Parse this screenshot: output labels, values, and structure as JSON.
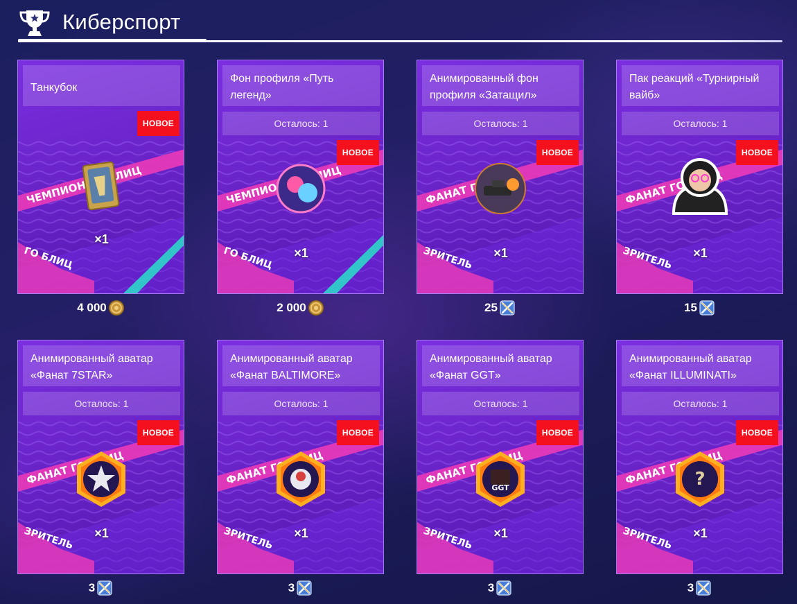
{
  "header": {
    "title": "Киберспорт",
    "icon": "trophy-icon"
  },
  "colors": {
    "badge": "#f5101e",
    "card": "#6a24c9",
    "accent_pink": "#e83ab8",
    "background": "#1b1f5e"
  },
  "cards": [
    {
      "title": "Танкубок",
      "remaining": "",
      "badge": "НОВОЕ",
      "quantity": "×1",
      "price": "4 000",
      "currency_icon": "gold-coin-icon",
      "item_icon": "tank-cup-icon"
    },
    {
      "title": "Фон профиля «Путь легенд»",
      "remaining": "Осталось: 1",
      "badge": "НОВОЕ",
      "quantity": "×1",
      "price": "2 000",
      "currency_icon": "gold-coin-icon",
      "item_icon": "profile-background-icon"
    },
    {
      "title": "Анимированный фон профиля «Затащил»",
      "remaining": "Осталось: 1",
      "badge": "НОВОЕ",
      "quantity": "×1",
      "price": "25",
      "currency_icon": "crossed-swords-icon",
      "item_icon": "animated-background-icon"
    },
    {
      "title": "Пак реакций «Турнирный вайб»",
      "remaining": "Осталось: 1",
      "badge": "НОВОЕ",
      "quantity": "×1",
      "price": "15",
      "currency_icon": "crossed-swords-icon",
      "item_icon": "reaction-pack-icon"
    },
    {
      "title": "Анимированный аватар «Фанат 7STAR»",
      "remaining": "Осталось: 1",
      "badge": "НОВОЕ",
      "quantity": "×1",
      "price": "3",
      "currency_icon": "crossed-swords-icon",
      "item_icon": "star-avatar-icon"
    },
    {
      "title": "Анимированный аватар «Фанат BALTIMORE»",
      "remaining": "Осталось: 1",
      "badge": "НОВОЕ",
      "quantity": "×1",
      "price": "3",
      "currency_icon": "crossed-swords-icon",
      "item_icon": "baltimore-avatar-icon"
    },
    {
      "title": "Анимированный аватар «Фанат GGT»",
      "remaining": "Осталось: 1",
      "badge": "НОВОЕ",
      "quantity": "×1",
      "price": "3",
      "currency_icon": "crossed-swords-icon",
      "item_icon": "ggt-avatar-icon",
      "item_icon_text": "GGT"
    },
    {
      "title": "Анимированный аватар «Фанат ILLUMINATI»",
      "remaining": "Осталось: 1",
      "badge": "НОВОЕ",
      "quantity": "×1",
      "price": "3",
      "currency_icon": "crossed-swords-icon",
      "item_icon": "illuminati-avatar-icon",
      "item_icon_text": "?"
    }
  ]
}
